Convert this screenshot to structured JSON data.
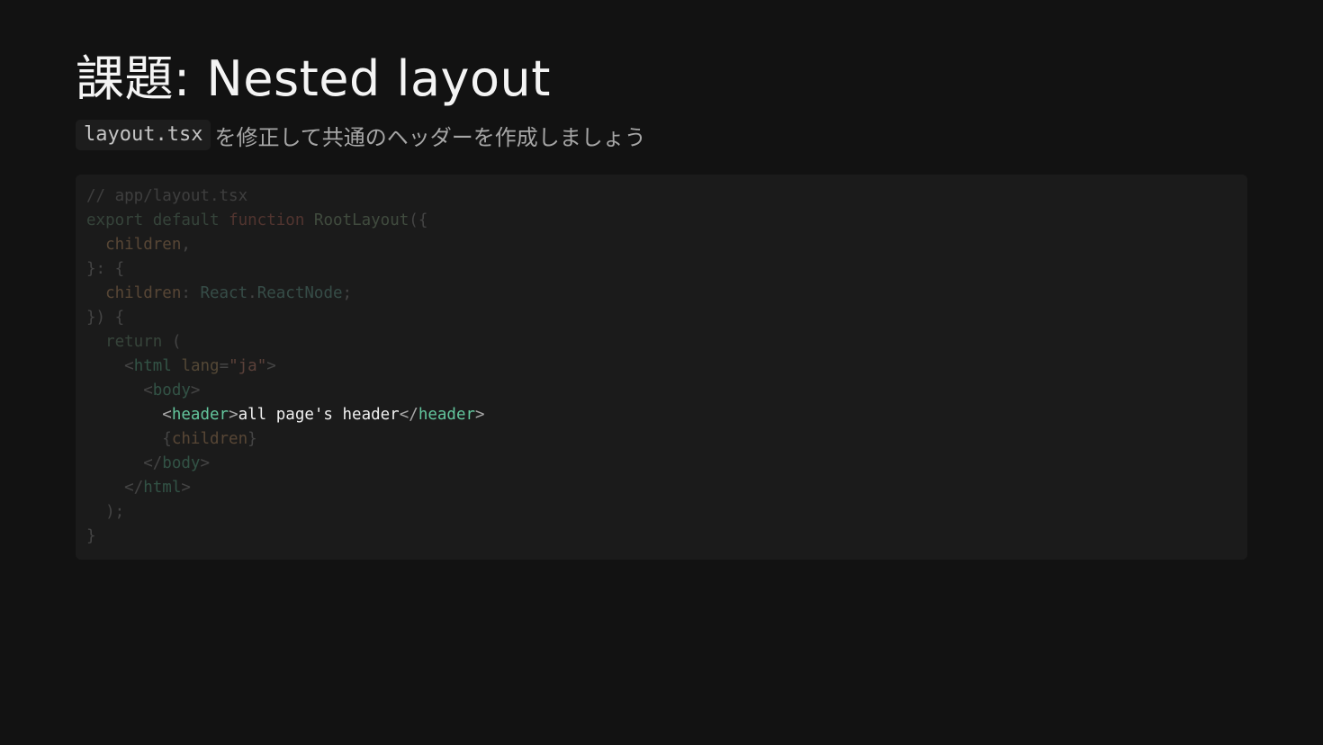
{
  "slide": {
    "title": "課題: Nested layout",
    "subtitle_code": "layout.tsx",
    "subtitle_text": "を修正して共通のヘッダーを作成しましょう"
  },
  "code_block": {
    "language": "tsx",
    "highlighted_line": 9,
    "lines": [
      {
        "tokens": [
          {
            "t": "// app/layout.tsx",
            "k": "comment"
          }
        ]
      },
      {
        "tokens": [
          {
            "t": "export",
            "k": "keyword"
          },
          {
            "t": " ",
            "k": "text"
          },
          {
            "t": "default",
            "k": "keyword"
          },
          {
            "t": " ",
            "k": "text"
          },
          {
            "t": "function",
            "k": "function-kw"
          },
          {
            "t": " ",
            "k": "text"
          },
          {
            "t": "RootLayout",
            "k": "name"
          },
          {
            "t": "({",
            "k": "punct"
          }
        ]
      },
      {
        "tokens": [
          {
            "t": "  ",
            "k": "text"
          },
          {
            "t": "children",
            "k": "prop"
          },
          {
            "t": ",",
            "k": "punct"
          }
        ]
      },
      {
        "tokens": [
          {
            "t": "}: {",
            "k": "punct"
          }
        ]
      },
      {
        "tokens": [
          {
            "t": "  ",
            "k": "text"
          },
          {
            "t": "children",
            "k": "prop"
          },
          {
            "t": ": ",
            "k": "punct"
          },
          {
            "t": "React",
            "k": "type"
          },
          {
            "t": ".",
            "k": "punct"
          },
          {
            "t": "ReactNode",
            "k": "type"
          },
          {
            "t": ";",
            "k": "punct"
          }
        ]
      },
      {
        "tokens": [
          {
            "t": "}) {",
            "k": "punct"
          }
        ]
      },
      {
        "tokens": [
          {
            "t": "  ",
            "k": "text"
          },
          {
            "t": "return",
            "k": "keyword"
          },
          {
            "t": " (",
            "k": "punct"
          }
        ]
      },
      {
        "tokens": [
          {
            "t": "    ",
            "k": "text"
          },
          {
            "t": "<",
            "k": "punct"
          },
          {
            "t": "html",
            "k": "tag"
          },
          {
            "t": " ",
            "k": "text"
          },
          {
            "t": "lang",
            "k": "attr"
          },
          {
            "t": "=",
            "k": "punct"
          },
          {
            "t": "\"ja\"",
            "k": "string"
          },
          {
            "t": ">",
            "k": "punct"
          }
        ]
      },
      {
        "tokens": [
          {
            "t": "      ",
            "k": "text"
          },
          {
            "t": "<",
            "k": "punct"
          },
          {
            "t": "body",
            "k": "tag"
          },
          {
            "t": ">",
            "k": "punct"
          }
        ]
      },
      {
        "tokens": [
          {
            "t": "        ",
            "k": "text"
          },
          {
            "t": "<",
            "k": "punct"
          },
          {
            "t": "header",
            "k": "tag"
          },
          {
            "t": ">",
            "k": "punct"
          },
          {
            "t": "all page's header",
            "k": "text"
          },
          {
            "t": "</",
            "k": "punct"
          },
          {
            "t": "header",
            "k": "tag"
          },
          {
            "t": ">",
            "k": "punct"
          }
        ]
      },
      {
        "tokens": [
          {
            "t": "        ",
            "k": "text"
          },
          {
            "t": "{",
            "k": "punct"
          },
          {
            "t": "children",
            "k": "prop"
          },
          {
            "t": "}",
            "k": "punct"
          }
        ]
      },
      {
        "tokens": [
          {
            "t": "      ",
            "k": "text"
          },
          {
            "t": "</",
            "k": "punct"
          },
          {
            "t": "body",
            "k": "tag"
          },
          {
            "t": ">",
            "k": "punct"
          }
        ]
      },
      {
        "tokens": [
          {
            "t": "    ",
            "k": "text"
          },
          {
            "t": "</",
            "k": "punct"
          },
          {
            "t": "html",
            "k": "tag"
          },
          {
            "t": ">",
            "k": "punct"
          }
        ]
      },
      {
        "tokens": [
          {
            "t": "  );",
            "k": "punct"
          }
        ]
      },
      {
        "tokens": [
          {
            "t": "}",
            "k": "punct"
          }
        ]
      }
    ]
  },
  "colors": {
    "background": "#121212",
    "code_background": "#1b1b1b",
    "title": "#f4f4f4",
    "subtitle": "#a6a6a6",
    "tag": "#63c69d"
  }
}
